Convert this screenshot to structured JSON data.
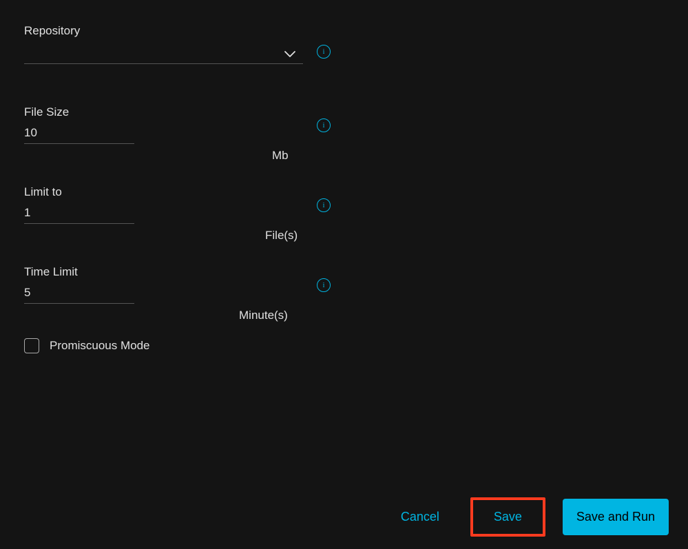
{
  "fields": {
    "repository": {
      "label": "Repository",
      "value": ""
    },
    "fileSize": {
      "label": "File Size",
      "value": "10",
      "unit": "Mb"
    },
    "limitTo": {
      "label": "Limit to",
      "value": "1",
      "unit": "File(s)"
    },
    "timeLimit": {
      "label": "Time Limit",
      "value": "5",
      "unit": "Minute(s)"
    },
    "promiscuous": {
      "label": "Promiscuous Mode",
      "checked": false
    }
  },
  "buttons": {
    "cancel": "Cancel",
    "save": "Save",
    "saveAndRun": "Save and Run"
  }
}
